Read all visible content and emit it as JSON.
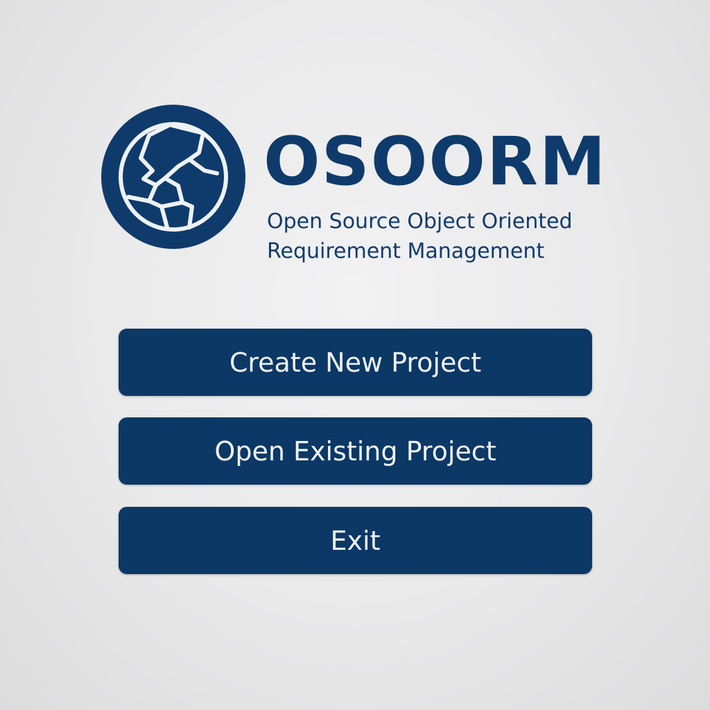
{
  "app": {
    "name": "OSOORM",
    "subtitle_line1": "Open Source Object Oriented",
    "subtitle_line2": "Requirement Management"
  },
  "logo": {
    "icon": "aperture-logo-icon"
  },
  "menu": {
    "create_label": "Create New Project",
    "open_label": "Open Existing Project",
    "exit_label": "Exit"
  },
  "colors": {
    "brand": "#0f3b6c",
    "button_bg": "#0c3866",
    "button_text": "#eef2f6",
    "background": "#e9e9ea"
  }
}
